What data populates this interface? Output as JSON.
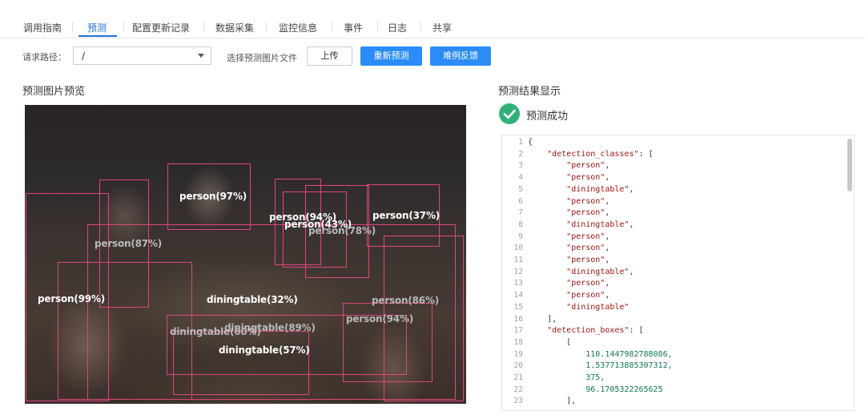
{
  "tabs": [
    {
      "label": "调用指南"
    },
    {
      "label": "预测"
    },
    {
      "label": "配置更新记录"
    },
    {
      "label": "数据采集"
    },
    {
      "label": "监控信息"
    },
    {
      "label": "事件"
    },
    {
      "label": "日志"
    },
    {
      "label": "共享"
    }
  ],
  "toolbar": {
    "path_label": "请求路径：",
    "path_value": "/",
    "file_label": "选择预测图片文件",
    "upload_label": "上传",
    "repredict_label": "重新预测",
    "feedback_label": "难例反馈"
  },
  "preview": {
    "title": "预测图片预览",
    "detections": [
      {
        "label": "person(97%)",
        "tone": "w"
      },
      {
        "label": "person(94%)",
        "tone": "w"
      },
      {
        "label": "person(43%)",
        "tone": "w"
      },
      {
        "label": "person(78%)",
        "tone": "g"
      },
      {
        "label": "person(37%)",
        "tone": "w"
      },
      {
        "label": "person(87%)",
        "tone": "g"
      },
      {
        "label": "person(99%)",
        "tone": "w"
      },
      {
        "label": "person(86%)",
        "tone": "g"
      },
      {
        "label": "person(94%)",
        "tone": "g"
      },
      {
        "label": "diningtable(32%)",
        "tone": "w"
      },
      {
        "label": "diningtable(89%)",
        "tone": "g"
      },
      {
        "label": "diningtable(60%)",
        "tone": "g"
      },
      {
        "label": "diningtable(57%)",
        "tone": "w"
      }
    ]
  },
  "result": {
    "title": "预测结果显示",
    "status": "预测成功",
    "status_color": "#31b07a",
    "code_lines": [
      {
        "n": "1",
        "text": "{"
      },
      {
        "n": "2",
        "text": "    \"detection_classes\": ["
      },
      {
        "n": "3",
        "text": "        \"person\","
      },
      {
        "n": "4",
        "text": "        \"person\","
      },
      {
        "n": "5",
        "text": "        \"diningtable\","
      },
      {
        "n": "6",
        "text": "        \"person\","
      },
      {
        "n": "7",
        "text": "        \"person\","
      },
      {
        "n": "8",
        "text": "        \"diningtable\","
      },
      {
        "n": "9",
        "text": "        \"person\","
      },
      {
        "n": "10",
        "text": "        \"person\","
      },
      {
        "n": "11",
        "text": "        \"person\","
      },
      {
        "n": "12",
        "text": "        \"diningtable\","
      },
      {
        "n": "13",
        "text": "        \"person\","
      },
      {
        "n": "14",
        "text": "        \"person\","
      },
      {
        "n": "15",
        "text": "        \"diningtable\""
      },
      {
        "n": "16",
        "text": "    ],"
      },
      {
        "n": "17",
        "text": "    \"detection_boxes\": ["
      },
      {
        "n": "18",
        "text": "        ["
      },
      {
        "n": "19",
        "text": "            110.1447982788086,"
      },
      {
        "n": "20",
        "text": "            1.537713885307312,"
      },
      {
        "n": "21",
        "text": "            375,"
      },
      {
        "n": "22",
        "text": "            96.1705322265625"
      },
      {
        "n": "23",
        "text": "        ],"
      }
    ]
  },
  "colors": {
    "accent": "#1e6fd9",
    "primary_button": "#2b8cf7",
    "box": "#e0457f"
  }
}
